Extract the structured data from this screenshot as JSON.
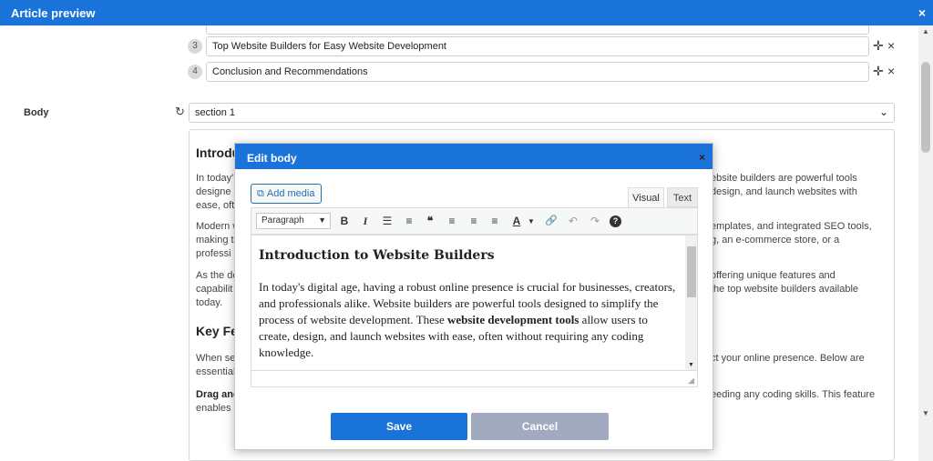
{
  "window": {
    "title": "Article preview",
    "close_glyph": "×"
  },
  "outline": [
    {
      "num": "3",
      "value": "Top Website Builders for Easy Website Development"
    },
    {
      "num": "4",
      "value": "Conclusion and Recommendations"
    }
  ],
  "row_controls": {
    "move_glyph": "✛",
    "delete_glyph": "×"
  },
  "body": {
    "label": "Body",
    "refresh_glyph": "↻",
    "section_selected": "section 1",
    "section_chevron": "⌄"
  },
  "article": {
    "h1": "Introdu",
    "p1_left": [
      "In today'",
      "designe",
      "ease, oft"
    ],
    "p1_right": [
      "ebsite builders are powerful tools",
      "design, and launch websites with",
      ""
    ],
    "p2_left": [
      "Modern w",
      "making t",
      "professi"
    ],
    "p2_right": [
      "emplates, and integrated SEO tools,",
      "g, an e-commerce store, or a",
      ""
    ],
    "p3_left": [
      "As the de",
      "capabilit",
      "today."
    ],
    "p3_right": [
      "offering unique features and",
      "the top website builders available",
      ""
    ],
    "h2": "Key Fe",
    "p4_left": [
      "When se",
      "essential"
    ],
    "p4_right": [
      "ct your online presence. Below are",
      ""
    ],
    "p5_left_bold": "Drag and",
    "p5_left2": "enables",
    "p5_right": "eeding any coding skills. This feature"
  },
  "modal": {
    "title": "Edit body",
    "close_glyph": "×",
    "add_media": "Add media",
    "tab_visual": "Visual",
    "tab_text": "Text",
    "format_select": "Paragraph",
    "editor_heading": "Introduction to Website Builders",
    "editor_para_start": "In today's digital age, having a robust online presence is crucial for businesses, creators, and professionals alike. Website builders are powerful tools designed to simplify the process of website development. These ",
    "editor_para_bold": "website development tools",
    "editor_para_end": " allow users to create, design, and launch websites with ease, often without requiring any coding knowledge.",
    "save": "Save",
    "cancel": "Cancel"
  },
  "toolbar_icons": {
    "bold": "B",
    "italic": "I",
    "bullets": "☰",
    "numbered": "≡",
    "quote": "❝",
    "align_left": "≡",
    "align_center": "≡",
    "align_right": "≡",
    "text_color": "A",
    "link": "🔗",
    "undo": "↶",
    "redo": "↷",
    "help": "?"
  },
  "colors": {
    "accent": "#1a73d9",
    "cancel": "#a2aac0"
  }
}
